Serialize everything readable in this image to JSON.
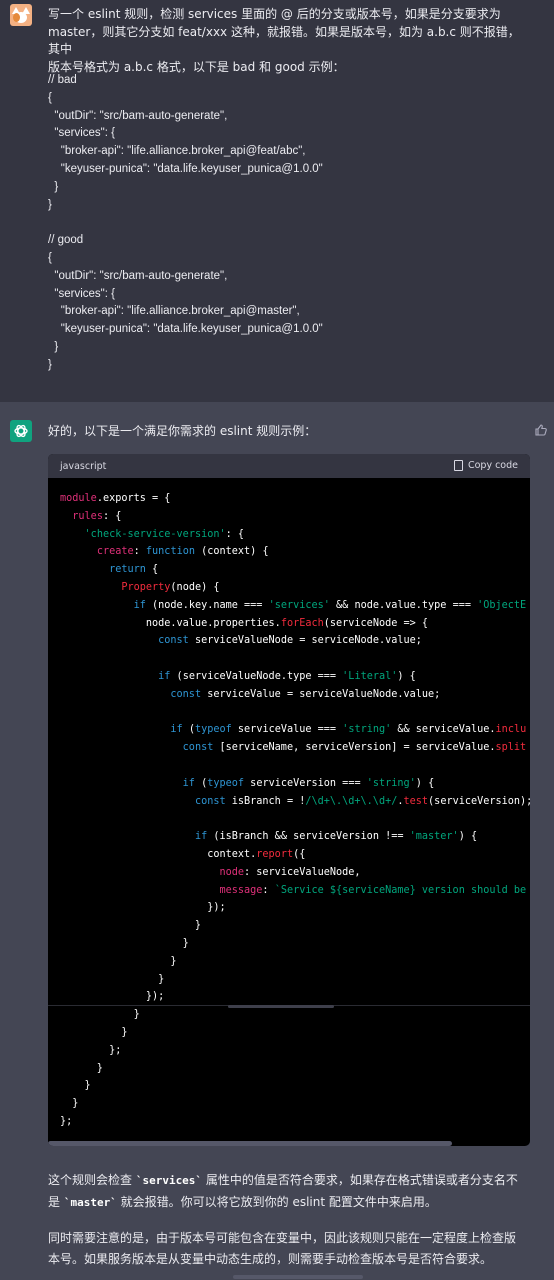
{
  "user": {
    "message_lines": [
      "写一个 eslint 规则，检测 services 里面的 @ 后的分支或版本号，如果是分支要求为",
      "master，则其它分支如 feat/xxx 这种，就报错。如果是版本号，如为 a.b.c 则不报错，其中",
      "版本号格式为 a.b.c 格式，以下是 bad 和 good 示例："
    ],
    "code_lines": [
      "// bad",
      "{",
      "  \"outDir\": \"src/bam-auto-generate\",",
      "  \"services\": {",
      "    \"broker-api\": \"life.alliance.broker_api@feat/abc\",",
      "    \"keyuser-punica\": \"data.life.keyuser_punica@1.0.0\"",
      "  }",
      "}",
      "",
      "// good",
      "{",
      "  \"outDir\": \"src/bam-auto-generate\",",
      "  \"services\": {",
      "    \"broker-api\": \"life.alliance.broker_api@master\",",
      "    \"keyuser-punica\": \"data.life.keyuser_punica@1.0.0\"",
      "  }",
      "}"
    ]
  },
  "assistant": {
    "intro": "好的，以下是一个满足你需求的 eslint 规则示例：",
    "code_lang": "javascript",
    "copy_label": "Copy code",
    "code_lines": [
      [
        [
          "t-obj",
          "module"
        ],
        [
          "t-plain",
          ".exports = {"
        ]
      ],
      [
        [
          "t-plain",
          "  "
        ],
        [
          "t-obj",
          "rules"
        ],
        [
          "t-plain",
          ": {"
        ]
      ],
      [
        [
          "t-plain",
          "    "
        ],
        [
          "t-str",
          "'check-service-version'"
        ],
        [
          "t-plain",
          ": {"
        ]
      ],
      [
        [
          "t-plain",
          "      "
        ],
        [
          "t-obj",
          "create"
        ],
        [
          "t-plain",
          ": "
        ],
        [
          "t-kw",
          "function"
        ],
        [
          "t-plain",
          " (context) {"
        ]
      ],
      [
        [
          "t-plain",
          "        "
        ],
        [
          "t-kw",
          "return"
        ],
        [
          "t-plain",
          " {"
        ]
      ],
      [
        [
          "t-plain",
          "          "
        ],
        [
          "t-fn",
          "Property"
        ],
        [
          "t-plain",
          "(node) {"
        ]
      ],
      [
        [
          "t-plain",
          "            "
        ],
        [
          "t-kw",
          "if"
        ],
        [
          "t-plain",
          " (node.key.name === "
        ],
        [
          "t-str",
          "'services'"
        ],
        [
          "t-plain",
          " && node.value.type === "
        ],
        [
          "t-str",
          "'ObjectE"
        ]
      ],
      [
        [
          "t-plain",
          "              node.value.properties."
        ],
        [
          "t-fn",
          "forEach"
        ],
        [
          "t-plain",
          "(serviceNode => {"
        ]
      ],
      [
        [
          "t-plain",
          "                "
        ],
        [
          "t-kw",
          "const"
        ],
        [
          "t-plain",
          " serviceValueNode = serviceNode.value;"
        ]
      ],
      [
        [
          "t-plain",
          ""
        ]
      ],
      [
        [
          "t-plain",
          "                "
        ],
        [
          "t-kw",
          "if"
        ],
        [
          "t-plain",
          " (serviceValueNode.type === "
        ],
        [
          "t-str",
          "'Literal'"
        ],
        [
          "t-plain",
          ") {"
        ]
      ],
      [
        [
          "t-plain",
          "                  "
        ],
        [
          "t-kw",
          "const"
        ],
        [
          "t-plain",
          " serviceValue = serviceValueNode.value;"
        ]
      ],
      [
        [
          "t-plain",
          ""
        ]
      ],
      [
        [
          "t-plain",
          "                  "
        ],
        [
          "t-kw",
          "if"
        ],
        [
          "t-plain",
          " ("
        ],
        [
          "t-kw",
          "typeof"
        ],
        [
          "t-plain",
          " serviceValue === "
        ],
        [
          "t-str",
          "'string'"
        ],
        [
          "t-plain",
          " && serviceValue."
        ],
        [
          "t-fn",
          "inclu"
        ]
      ],
      [
        [
          "t-plain",
          "                    "
        ],
        [
          "t-kw",
          "const"
        ],
        [
          "t-plain",
          " [serviceName, serviceVersion] = serviceValue."
        ],
        [
          "t-fn",
          "split"
        ]
      ],
      [
        [
          "t-plain",
          ""
        ]
      ],
      [
        [
          "t-plain",
          "                    "
        ],
        [
          "t-kw",
          "if"
        ],
        [
          "t-plain",
          " ("
        ],
        [
          "t-kw",
          "typeof"
        ],
        [
          "t-plain",
          " serviceVersion === "
        ],
        [
          "t-str",
          "'string'"
        ],
        [
          "t-plain",
          ") {"
        ]
      ],
      [
        [
          "t-plain",
          "                      "
        ],
        [
          "t-kw",
          "const"
        ],
        [
          "t-plain",
          " isBranch = !"
        ],
        [
          "t-str",
          "/\\d+\\.\\d+\\.\\d+/"
        ],
        [
          "t-plain",
          "."
        ],
        [
          "t-fn",
          "test"
        ],
        [
          "t-plain",
          "(serviceVersion);"
        ]
      ],
      [
        [
          "t-plain",
          ""
        ]
      ],
      [
        [
          "t-plain",
          "                      "
        ],
        [
          "t-kw",
          "if"
        ],
        [
          "t-plain",
          " (isBranch && serviceVersion !== "
        ],
        [
          "t-str",
          "'master'"
        ],
        [
          "t-plain",
          ") {"
        ]
      ],
      [
        [
          "t-plain",
          "                        context."
        ],
        [
          "t-fn",
          "report"
        ],
        [
          "t-plain",
          "({"
        ]
      ],
      [
        [
          "t-plain",
          "                          "
        ],
        [
          "t-obj",
          "node"
        ],
        [
          "t-plain",
          ": serviceValueNode,"
        ]
      ],
      [
        [
          "t-plain",
          "                          "
        ],
        [
          "t-obj",
          "message"
        ],
        [
          "t-plain",
          ": "
        ],
        [
          "t-str",
          "`Service ${serviceName} version should be"
        ]
      ],
      [
        [
          "t-plain",
          "                        });"
        ]
      ],
      [
        [
          "t-plain",
          "                      }"
        ]
      ],
      [
        [
          "t-plain",
          "                    }"
        ]
      ],
      [
        [
          "t-plain",
          "                  }"
        ]
      ],
      [
        [
          "t-plain",
          "                }"
        ]
      ],
      [
        [
          "t-plain",
          "              });"
        ]
      ],
      [
        [
          "t-plain",
          "            }"
        ]
      ],
      [
        [
          "t-plain",
          "          }"
        ]
      ],
      [
        [
          "t-plain",
          "        };"
        ]
      ],
      [
        [
          "t-plain",
          "      }"
        ]
      ],
      [
        [
          "t-plain",
          "    }"
        ]
      ],
      [
        [
          "t-plain",
          "  }"
        ]
      ],
      [
        [
          "t-plain",
          "};"
        ]
      ]
    ],
    "para1": [
      [
        "text",
        "这个规则会检查 "
      ],
      [
        "code",
        "`services`"
      ],
      [
        "text",
        " 属性中的值是否符合要求，如果存在格式错误或者分支名不是 "
      ],
      [
        "code",
        "`master`"
      ],
      [
        "text",
        " 就会报错。你可以将它放到你的 eslint 配置文件中来启用。"
      ]
    ],
    "para2": "同时需要注意的是，由于版本号可能包含在变量中，因此该规则只能在一定程度上检查版本号。如果服务版本是从变量中动态生成的，则需要手动检查版本号是否符合要求。"
  },
  "colors": {
    "user_bg": "#343541",
    "assistant_bg": "#444654",
    "code_bg": "#000000",
    "brand_green": "#10a37f"
  },
  "icons": [
    "user-avatar-icon",
    "chatgpt-logo-icon",
    "thumbs-up-icon",
    "clipboard-icon"
  ]
}
